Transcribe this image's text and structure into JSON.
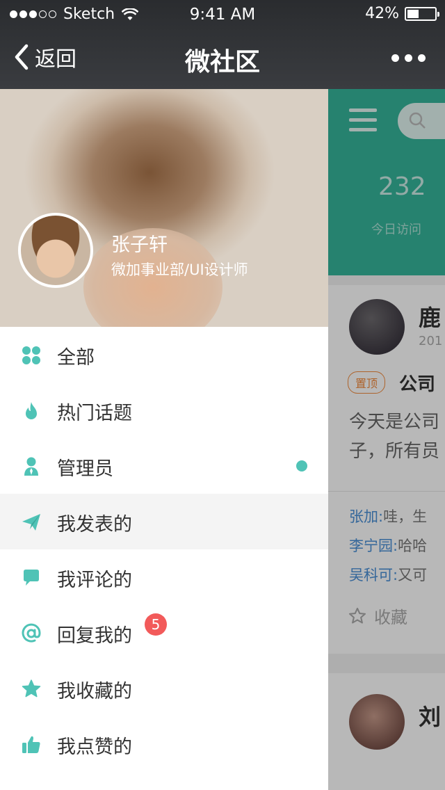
{
  "status": {
    "carrier": "Sketch",
    "time": "9:41 AM",
    "battery": "42%",
    "battery_level": 0.42
  },
  "nav": {
    "back_label": "返回",
    "title": "微社区"
  },
  "profile": {
    "name": "张子轩",
    "department": "微加事业部/UI设计师"
  },
  "menu": {
    "items": [
      {
        "label": "全部",
        "icon": "grid-icon"
      },
      {
        "label": "热门话题",
        "icon": "flame-icon"
      },
      {
        "label": "管理员",
        "icon": "admin-icon",
        "indicator": true
      },
      {
        "label": "我发表的",
        "icon": "paper-plane-icon",
        "active": true
      },
      {
        "label": "我评论的",
        "icon": "comment-icon"
      },
      {
        "label": "回复我的",
        "icon": "at-icon",
        "badge": "5"
      },
      {
        "label": "我收藏的",
        "icon": "star-icon"
      },
      {
        "label": "我点赞的",
        "icon": "thumbs-up-icon"
      }
    ]
  },
  "background_page": {
    "count": "232",
    "count_label": "今日访问",
    "post": {
      "author": "鹿",
      "date": "201",
      "tag": "置顶",
      "title": "公司",
      "line1": "今天是公司",
      "line2": "子，所有员"
    },
    "comments": [
      {
        "user": "张加:",
        "text": "哇，生"
      },
      {
        "user": "李宁园:",
        "text": "哈哈"
      },
      {
        "user": "吴科可:",
        "text": "又可"
      }
    ],
    "favorite_label": "收藏",
    "post2_author": "刘"
  },
  "colors": {
    "accent": "#4fc3b6",
    "header_green": "#35b59a",
    "badge_red": "#f25a5a",
    "navbar": "#323438"
  }
}
